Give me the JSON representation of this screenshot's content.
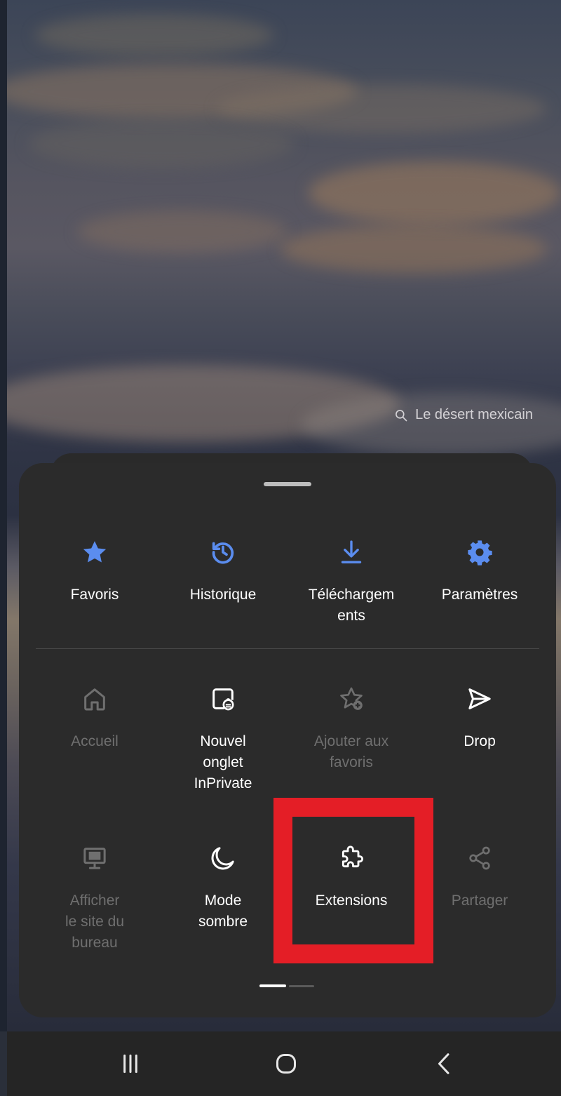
{
  "background": {
    "search_text": "Le désert mexicain"
  },
  "menu": {
    "row1": [
      {
        "label": "Favoris",
        "icon": "star-icon",
        "enabled": true
      },
      {
        "label": "Historique",
        "icon": "history-icon",
        "enabled": true
      },
      {
        "label": "Téléchargem\nents",
        "icon": "download-icon",
        "enabled": true
      },
      {
        "label": "Paramètres",
        "icon": "gear-icon",
        "enabled": true
      }
    ],
    "row2": [
      {
        "label": "Accueil",
        "icon": "home-icon",
        "enabled": false
      },
      {
        "label": "Nouvel\nonglet\nInPrivate",
        "icon": "inprivate-tab-icon",
        "enabled": true
      },
      {
        "label": "Ajouter aux\nfavoris",
        "icon": "star-add-icon",
        "enabled": false
      },
      {
        "label": "Drop",
        "icon": "send-icon",
        "enabled": true
      }
    ],
    "row3": [
      {
        "label": "Afficher\nle site du\nbureau",
        "icon": "desktop-icon",
        "enabled": false
      },
      {
        "label": "Mode\nsombre",
        "icon": "moon-icon",
        "enabled": true
      },
      {
        "label": "Extensions",
        "icon": "puzzle-icon",
        "enabled": true
      },
      {
        "label": "Partager",
        "icon": "share-icon",
        "enabled": false
      }
    ],
    "page_indicator": {
      "current": 1,
      "total": 2
    }
  },
  "colors": {
    "accent": "#5b8def",
    "sheet": "#2b2b2b",
    "highlight": "#e41e26",
    "disabled": "#6f6f6f"
  },
  "navbar": {
    "buttons": [
      "recent-apps-icon",
      "home-button-icon",
      "back-icon"
    ]
  }
}
